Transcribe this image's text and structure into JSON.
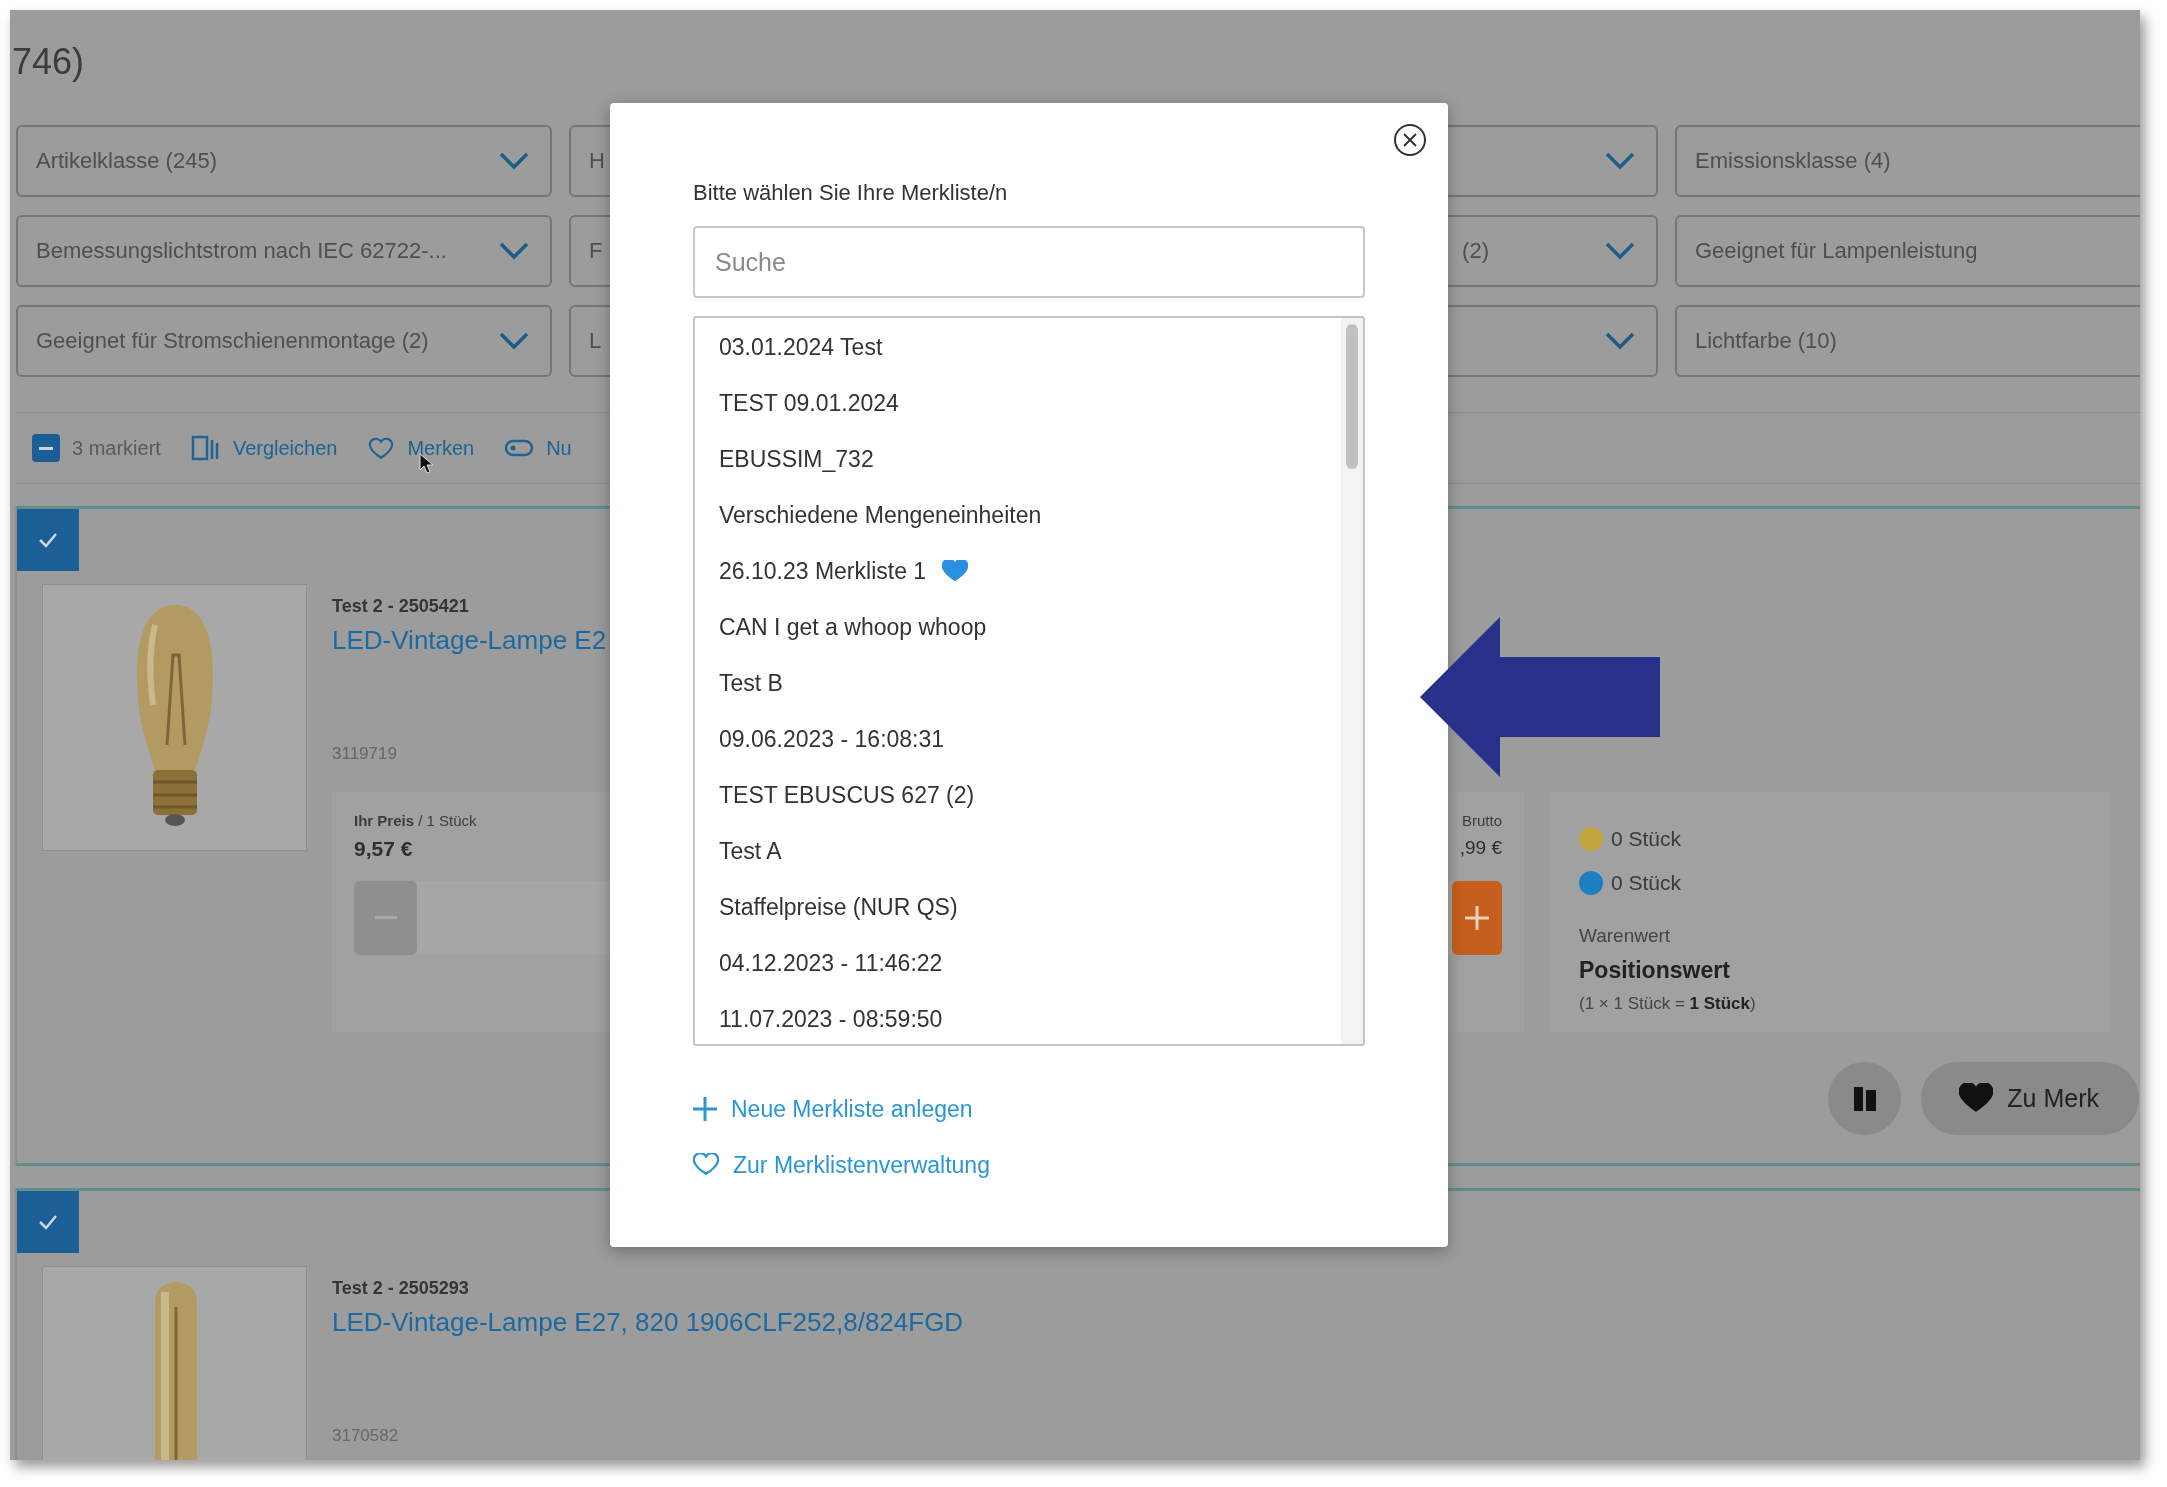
{
  "heading_fragment": "746)",
  "filters": [
    [
      {
        "label": "Artikelklasse (245)",
        "dropdown": true
      },
      {
        "label": "H"
      },
      {
        "dropdown": true
      },
      {
        "label": "Emissionsklasse (4)"
      }
    ],
    [
      {
        "label": "Bemessungslichtstrom nach IEC 62722-...",
        "dropdown": true
      },
      {
        "label": "F"
      },
      {
        "label": "(2)",
        "dropdown": true
      },
      {
        "label": "Geeignet für Lampenleistung"
      }
    ],
    [
      {
        "label": "Geeignet für Stromschienenmontage (2)",
        "dropdown": true
      },
      {
        "label": "L"
      },
      {
        "dropdown": true
      },
      {
        "label": "Lichtfarbe (10)"
      }
    ]
  ],
  "toolbar": {
    "select_all_partial": true,
    "selected_count": "3 markiert",
    "actions": [
      {
        "kind": "compare",
        "label": "Vergleichen"
      },
      {
        "kind": "heart",
        "label": "Merken"
      },
      {
        "kind": "tag",
        "label": "Nu"
      }
    ]
  },
  "products": [
    {
      "selected": true,
      "supplier": "Test 2 - 2505421",
      "title": "LED-Vintage-Lampe E2",
      "article_no": "3119719",
      "price_label": "Ihr Preis",
      "price_unit": "/ 1 Stück",
      "price": "9,57 €",
      "gross_label": "Brutto",
      "gross": ",99 €",
      "minus_disabled": true,
      "stock": [
        {
          "text": "0 Stück",
          "color": "#c2a43c"
        },
        {
          "text": "0 Stück",
          "color": "#1c7fbf"
        }
      ],
      "value_label": "Warenwert",
      "value_title": "Positionswert",
      "value_calc": "(1 × 1 Stück = **1 Stück**)",
      "actions": [
        {
          "kind": "icon"
        },
        {
          "kind": "pill",
          "label": "Zu Merk"
        }
      ]
    },
    {
      "selected": true,
      "supplier": "Test 2 - 2505293",
      "title": "LED-Vintage-Lampe E27, 820 1906CLF252,8/824FGD",
      "article_no": "3170582"
    }
  ],
  "dialog": {
    "title": "Bitte wählen Sie Ihre Merkliste/n",
    "search": {
      "placeholder": "Suche"
    },
    "lists": [
      {
        "name": "03.01.2024 Test",
        "favorite": false
      },
      {
        "name": "TEST 09.01.2024",
        "favorite": false
      },
      {
        "name": "EBUSSIM_732",
        "favorite": false
      },
      {
        "name": "Verschiedene Mengeneinheiten",
        "favorite": false
      },
      {
        "name": "26.10.23 Merkliste 1",
        "favorite": true
      },
      {
        "name": "CAN I get a whoop whoop",
        "favorite": false
      },
      {
        "name": "Test B",
        "favorite": false
      },
      {
        "name": "09.06.2023 - 16:08:31",
        "favorite": false
      },
      {
        "name": "TEST EBUSCUS 627 (2)",
        "favorite": false
      },
      {
        "name": "Test A",
        "favorite": false
      },
      {
        "name": "Staffelpreise (NUR QS)",
        "favorite": false
      },
      {
        "name": "04.12.2023 - 11:46:22",
        "favorite": false
      },
      {
        "name": "11.07.2023 - 08:59:50",
        "favorite": false
      }
    ],
    "links": [
      {
        "kind": "add",
        "label": "Neue Merkliste anlegen"
      },
      {
        "kind": "manage",
        "label": "Zur Merklistenverwaltung"
      }
    ]
  }
}
